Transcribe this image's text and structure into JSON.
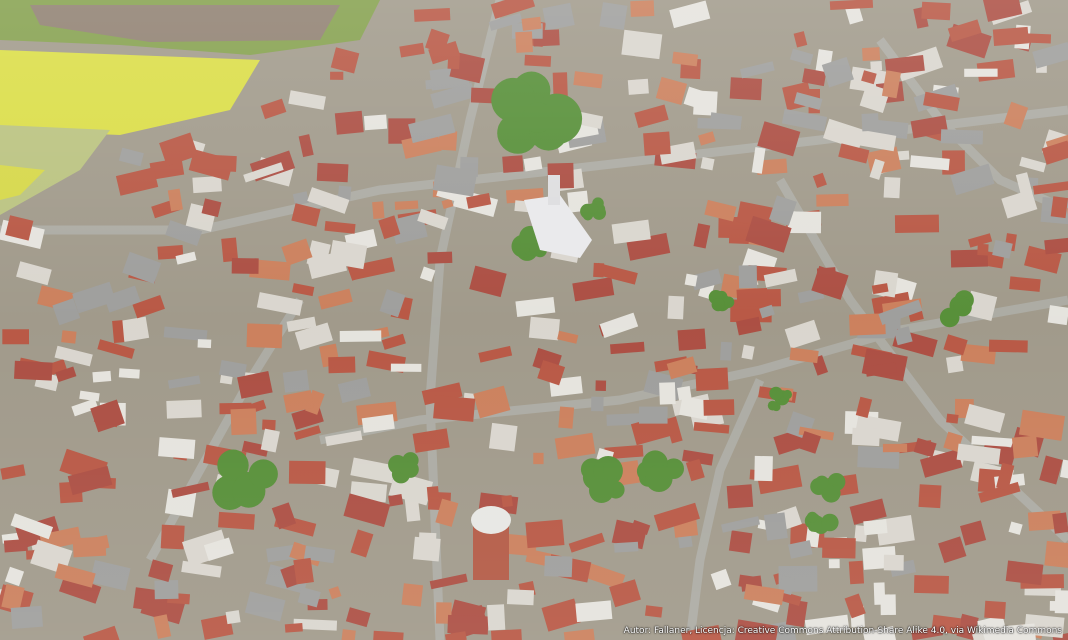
{
  "photo": {
    "subject": "aerial-town-view",
    "colors": {
      "roof_red": "#b5503c",
      "roof_orange": "#c97a55",
      "roof_grey": "#9a9a98",
      "field_yellow": "#d9dc3e",
      "field_green": "#8fae4a",
      "tree_green": "#4f8a2f",
      "road_grey": "#a8a79f"
    }
  },
  "credit": {
    "text": "Autor: Fallaner, Licencja: Creative Commons Attribution-Share Alike 4.0, via Wikimedia Commons"
  }
}
